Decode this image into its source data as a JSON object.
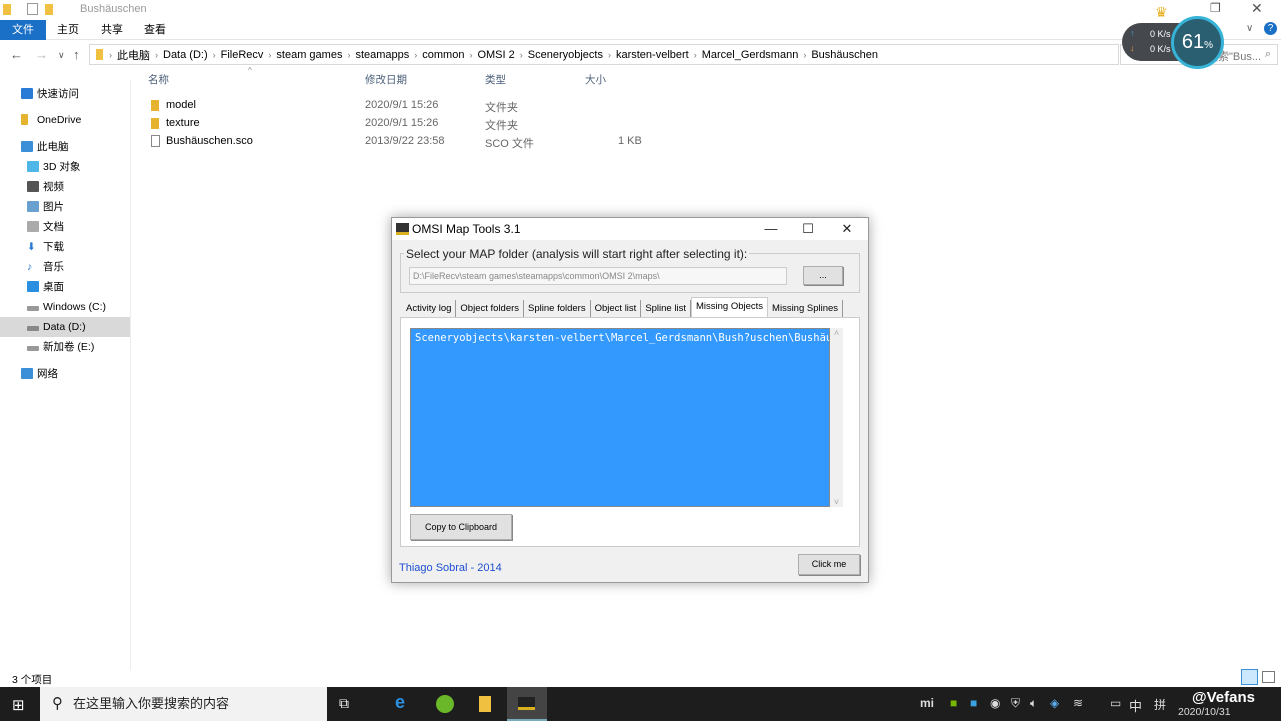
{
  "window": {
    "title": "Bushäuschen"
  },
  "ribbon": {
    "tabs": [
      "文件",
      "主页",
      "共享",
      "查看"
    ]
  },
  "address": {
    "crumbs": [
      "此电脑",
      "Data (D:)",
      "FileRecv",
      "steam games",
      "steamapps",
      "common",
      "OMSI 2",
      "Sceneryobjects",
      "karsten-velbert",
      "Marcel_Gerdsmann",
      "Bushäuschen"
    ],
    "search_placeholder": "搜索\"Bus..."
  },
  "sidebar": {
    "items": [
      {
        "label": "快速访问",
        "color": "#2a7bd6"
      },
      {
        "label": "OneDrive",
        "color": "#e6b32f"
      },
      {
        "label": "此电脑",
        "color": "#3a8fd8"
      },
      {
        "label": "3D 对象",
        "color": "#4fb7e8"
      },
      {
        "label": "视频",
        "color": "#555"
      },
      {
        "label": "图片",
        "color": "#6aa0d0"
      },
      {
        "label": "文档",
        "color": "#8a8a8a"
      },
      {
        "label": "下载",
        "color": "#2a7bd6"
      },
      {
        "label": "音乐",
        "color": "#2a7bd6"
      },
      {
        "label": "桌面",
        "color": "#2a8fe0"
      },
      {
        "label": "Windows (C:)",
        "color": "#777"
      },
      {
        "label": "Data (D:)",
        "color": "#777"
      },
      {
        "label": "新加卷 (E:)",
        "color": "#777"
      },
      {
        "label": "网络",
        "color": "#3a8fd8"
      }
    ]
  },
  "columns": [
    "名称",
    "修改日期",
    "类型",
    "大小"
  ],
  "files": [
    {
      "name": "model",
      "date": "2020/9/1 15:26",
      "type": "文件夹",
      "size": ""
    },
    {
      "name": "texture",
      "date": "2020/9/1 15:26",
      "type": "文件夹",
      "size": ""
    },
    {
      "name": "Bushäuschen.sco",
      "date": "2013/9/22 23:58",
      "type": "SCO 文件",
      "size": "1 KB"
    }
  ],
  "status": "3 个项目",
  "widget": {
    "up": "0 K/s",
    "down": "0 K/s",
    "percent": "61",
    "pct_sign": "%"
  },
  "dialog": {
    "title": "OMSI Map Tools 3.1",
    "group_label": "Select your MAP folder (analysis will start right after selecting it):",
    "path": "D:\\FileRecv\\steam games\\steamapps\\common\\OMSI 2\\maps\\",
    "browse": "...",
    "tabs": [
      "Activity log",
      "Object folders",
      "Spline folders",
      "Object list",
      "Spline list",
      "Missing Objects",
      "Missing Splines"
    ],
    "active_tab": "Missing Objects",
    "list_item": "Sceneryobjects\\karsten-velbert\\Marcel_Gerdsmann\\Bush?uschen\\Bushäuschen.sco",
    "copy": "Copy to Clipboard",
    "credit": "Thiago Sobral - 2014",
    "click": "Click me"
  },
  "taskbar": {
    "search": "在这里输入你要搜索的内容",
    "ime1": "中",
    "ime2": "拼",
    "date": "2020/10/31",
    "watermark": "@Vefans"
  }
}
